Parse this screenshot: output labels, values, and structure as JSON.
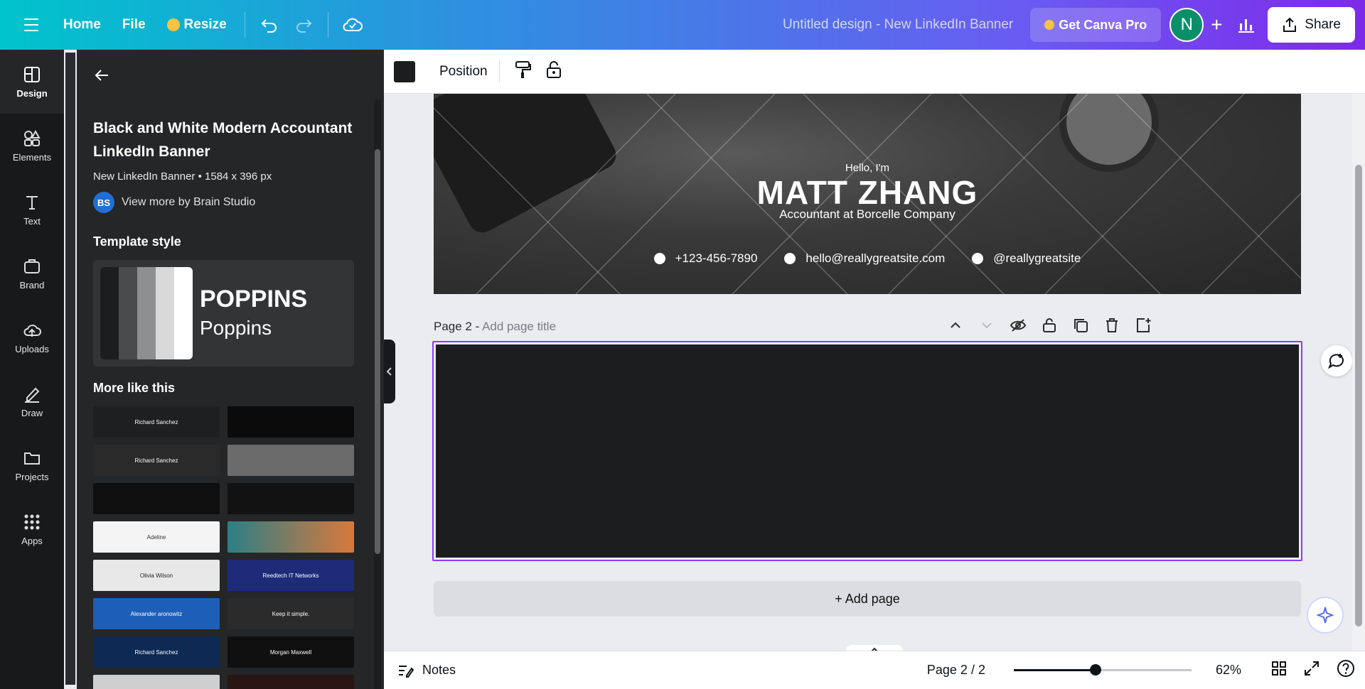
{
  "topbar": {
    "home": "Home",
    "file": "File",
    "resize": "Resize",
    "design_title": "Untitled design - New LinkedIn Banner",
    "get_pro": "Get Canva Pro",
    "avatar_initial": "N",
    "share": "Share"
  },
  "rail": {
    "items": [
      {
        "label": "Design",
        "icon": "design-icon"
      },
      {
        "label": "Elements",
        "icon": "elements-icon"
      },
      {
        "label": "Text",
        "icon": "text-icon"
      },
      {
        "label": "Brand",
        "icon": "brand-icon"
      },
      {
        "label": "Uploads",
        "icon": "uploads-icon"
      },
      {
        "label": "Draw",
        "icon": "draw-icon"
      },
      {
        "label": "Projects",
        "icon": "projects-icon"
      },
      {
        "label": "Apps",
        "icon": "apps-icon"
      }
    ]
  },
  "panel": {
    "title": "Black and White Modern Accountant LinkedIn Banner",
    "meta": "New LinkedIn Banner • 1584 x 396 px",
    "author_initials": "BS",
    "author_link": "View more by Brain Studio",
    "template_style_heading": "Template style",
    "font_heading": "POPPINS",
    "font_body": "Poppins",
    "swatch_colors": [
      "#1c1d1f",
      "#4a4b4d",
      "#8e8f91",
      "#d9d9d9",
      "#ffffff"
    ],
    "more_heading": "More like this",
    "thumbs": [
      {
        "label": "Richard Sanchez",
        "bg": "#1e1f21"
      },
      {
        "label": "",
        "bg": "#0b0b0c"
      },
      {
        "label": "Richard Sanchez",
        "bg": "#2a2a2b"
      },
      {
        "label": "",
        "bg": "#6b6b6b"
      },
      {
        "label": "",
        "bg": "#0f0f10"
      },
      {
        "label": "",
        "bg": "#121213"
      },
      {
        "label": "Adeline",
        "bg": "#f4f4f4"
      },
      {
        "label": "",
        "bg": "#2c7f86"
      },
      {
        "label": "Olivia Wilson",
        "bg": "#e8e8e8"
      },
      {
        "label": "Reedtech IT Networks",
        "bg": "#1d2b78"
      },
      {
        "label": "Alexander aronowitz",
        "bg": "#1d5fb8"
      },
      {
        "label": "Keep it simple.",
        "bg": "#2b2b2c"
      },
      {
        "label": "Richard Sanchez",
        "bg": "#0d2a55"
      },
      {
        "label": "Morgan Maxwell",
        "bg": "#101011"
      },
      {
        "label": "",
        "bg": "#cfcfcf"
      },
      {
        "label": "",
        "bg": "#2a1515"
      }
    ]
  },
  "context": {
    "position": "Position",
    "fill_color": "#1c1d1f"
  },
  "banner": {
    "greeting": "Hello, I'm",
    "name": "MATT ZHANG",
    "role": "Accountant at Borcelle Company",
    "phone": "+123-456-7890",
    "email": "hello@reallygreatsite.com",
    "social": "@reallygreatsite"
  },
  "page2": {
    "label": "Page 2 -",
    "placeholder": "Add page title"
  },
  "canvas": {
    "add_page": "+ Add page",
    "selection_color": "#8b3dff"
  },
  "bottom": {
    "notes": "Notes",
    "page_count": "Page 2 / 2",
    "zoom": "62%",
    "zoom_value": 0.46
  }
}
